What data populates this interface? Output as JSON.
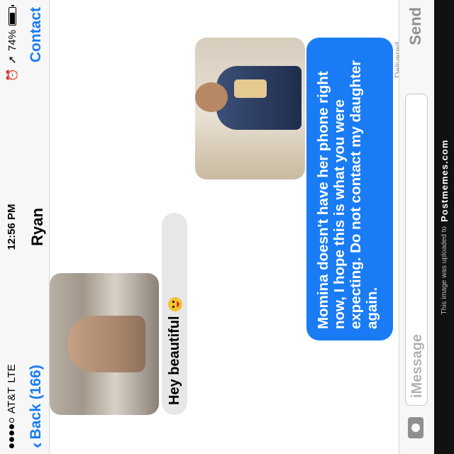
{
  "status": {
    "carrier": "AT&T",
    "network": "LTE",
    "time": "12:56 PM",
    "battery": "74%",
    "battery_level": 0.74
  },
  "nav": {
    "back_label": "Back (166)",
    "title": "Ryan",
    "contact_label": "Contact"
  },
  "messages": {
    "received_text": "Hey beautiful",
    "sent_text": "Momina doesn't have her phone right now, I hope this is what you were expecting. Do not contact my daughter again.",
    "delivered": "Delivered"
  },
  "input": {
    "placeholder": "iMessage",
    "send_label": "Send"
  },
  "watermark": {
    "prefix": "This image was uploaded to",
    "brand": "Postmemes.com"
  },
  "colors": {
    "accent": "#1a7cf5",
    "received_bubble": "#e7e7ea"
  }
}
